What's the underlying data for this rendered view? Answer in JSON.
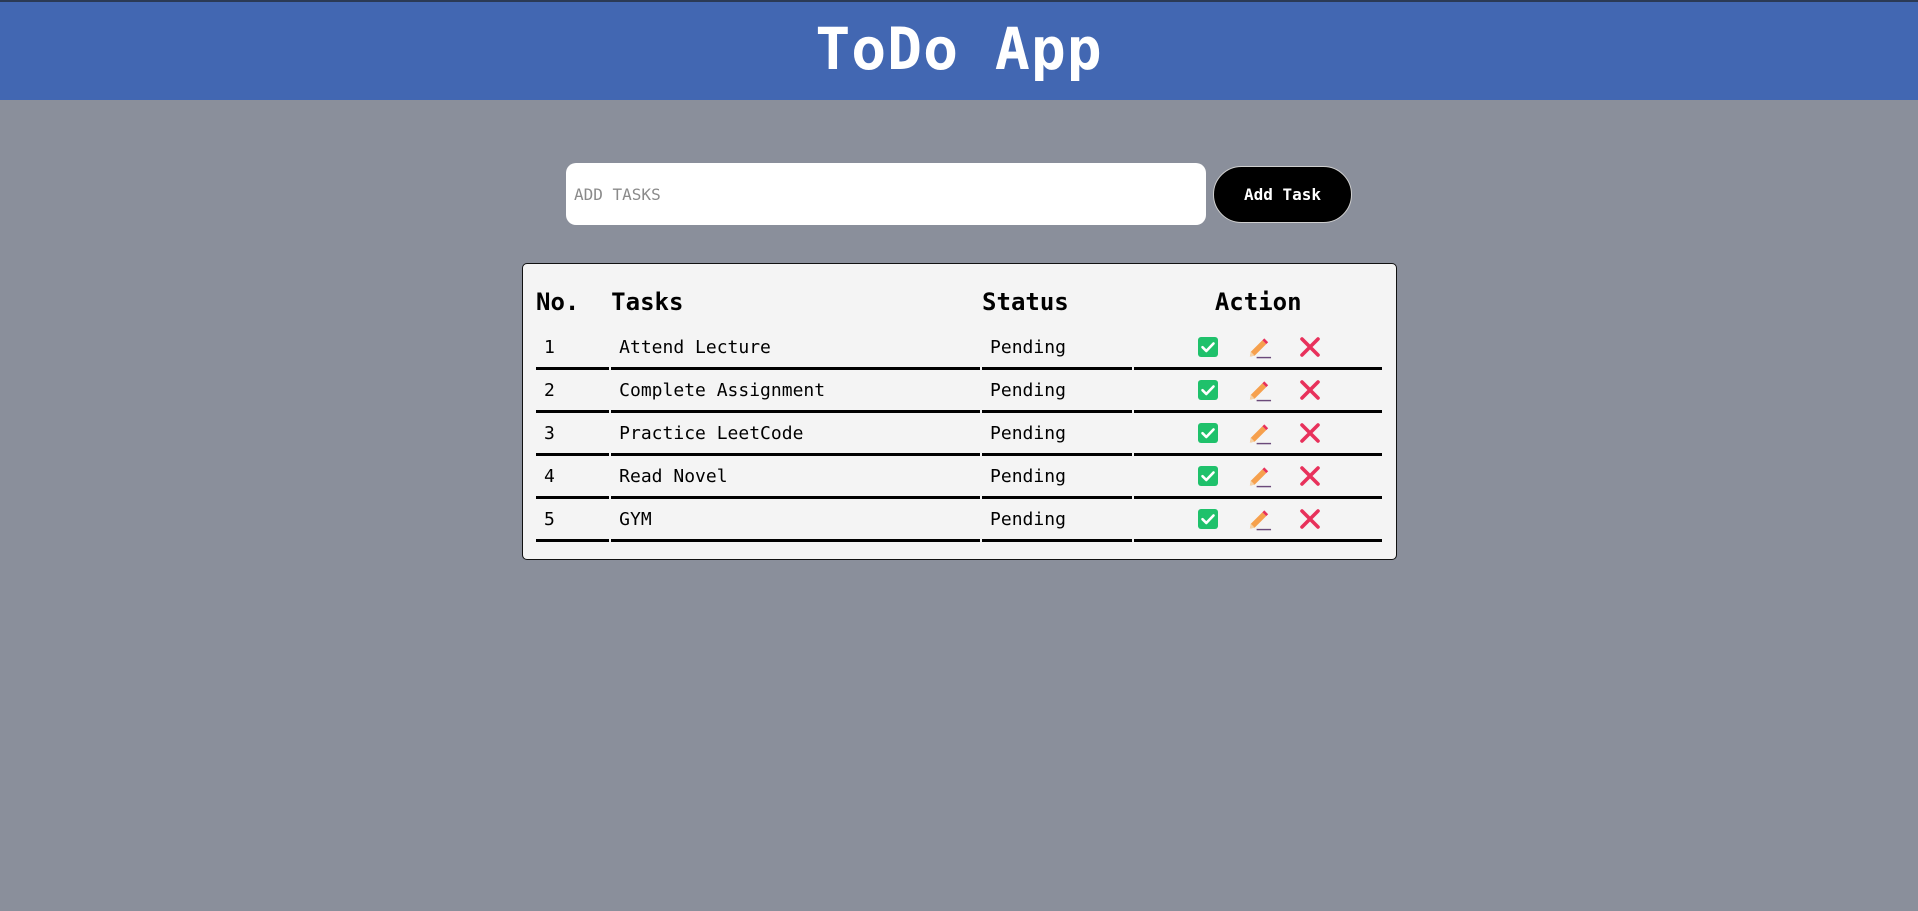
{
  "header": {
    "title": "ToDo App"
  },
  "input": {
    "placeholder": "ADD TASKS",
    "value": ""
  },
  "add_button": {
    "label": "Add Task"
  },
  "table": {
    "columns": [
      "No.",
      "Tasks",
      "Status",
      "Action"
    ],
    "rows": [
      {
        "no": "1",
        "task": "Attend Lecture",
        "status": "Pending"
      },
      {
        "no": "2",
        "task": "Complete Assignment",
        "status": "Pending"
      },
      {
        "no": "3",
        "task": "Practice LeetCode",
        "status": "Pending"
      },
      {
        "no": "4",
        "task": "Read Novel",
        "status": "Pending"
      },
      {
        "no": "5",
        "task": "GYM",
        "status": "Pending"
      }
    ],
    "action_icons": [
      "check-icon",
      "pencil-icon",
      "cross-icon"
    ]
  },
  "colors": {
    "page_background": "#8a8f9b",
    "header_background": "#4267b2",
    "table_background": "#f4f4f4",
    "check_green": "#1fc16b",
    "pencil_orange": "#f6a04d",
    "cross_red": "#e8315b"
  }
}
